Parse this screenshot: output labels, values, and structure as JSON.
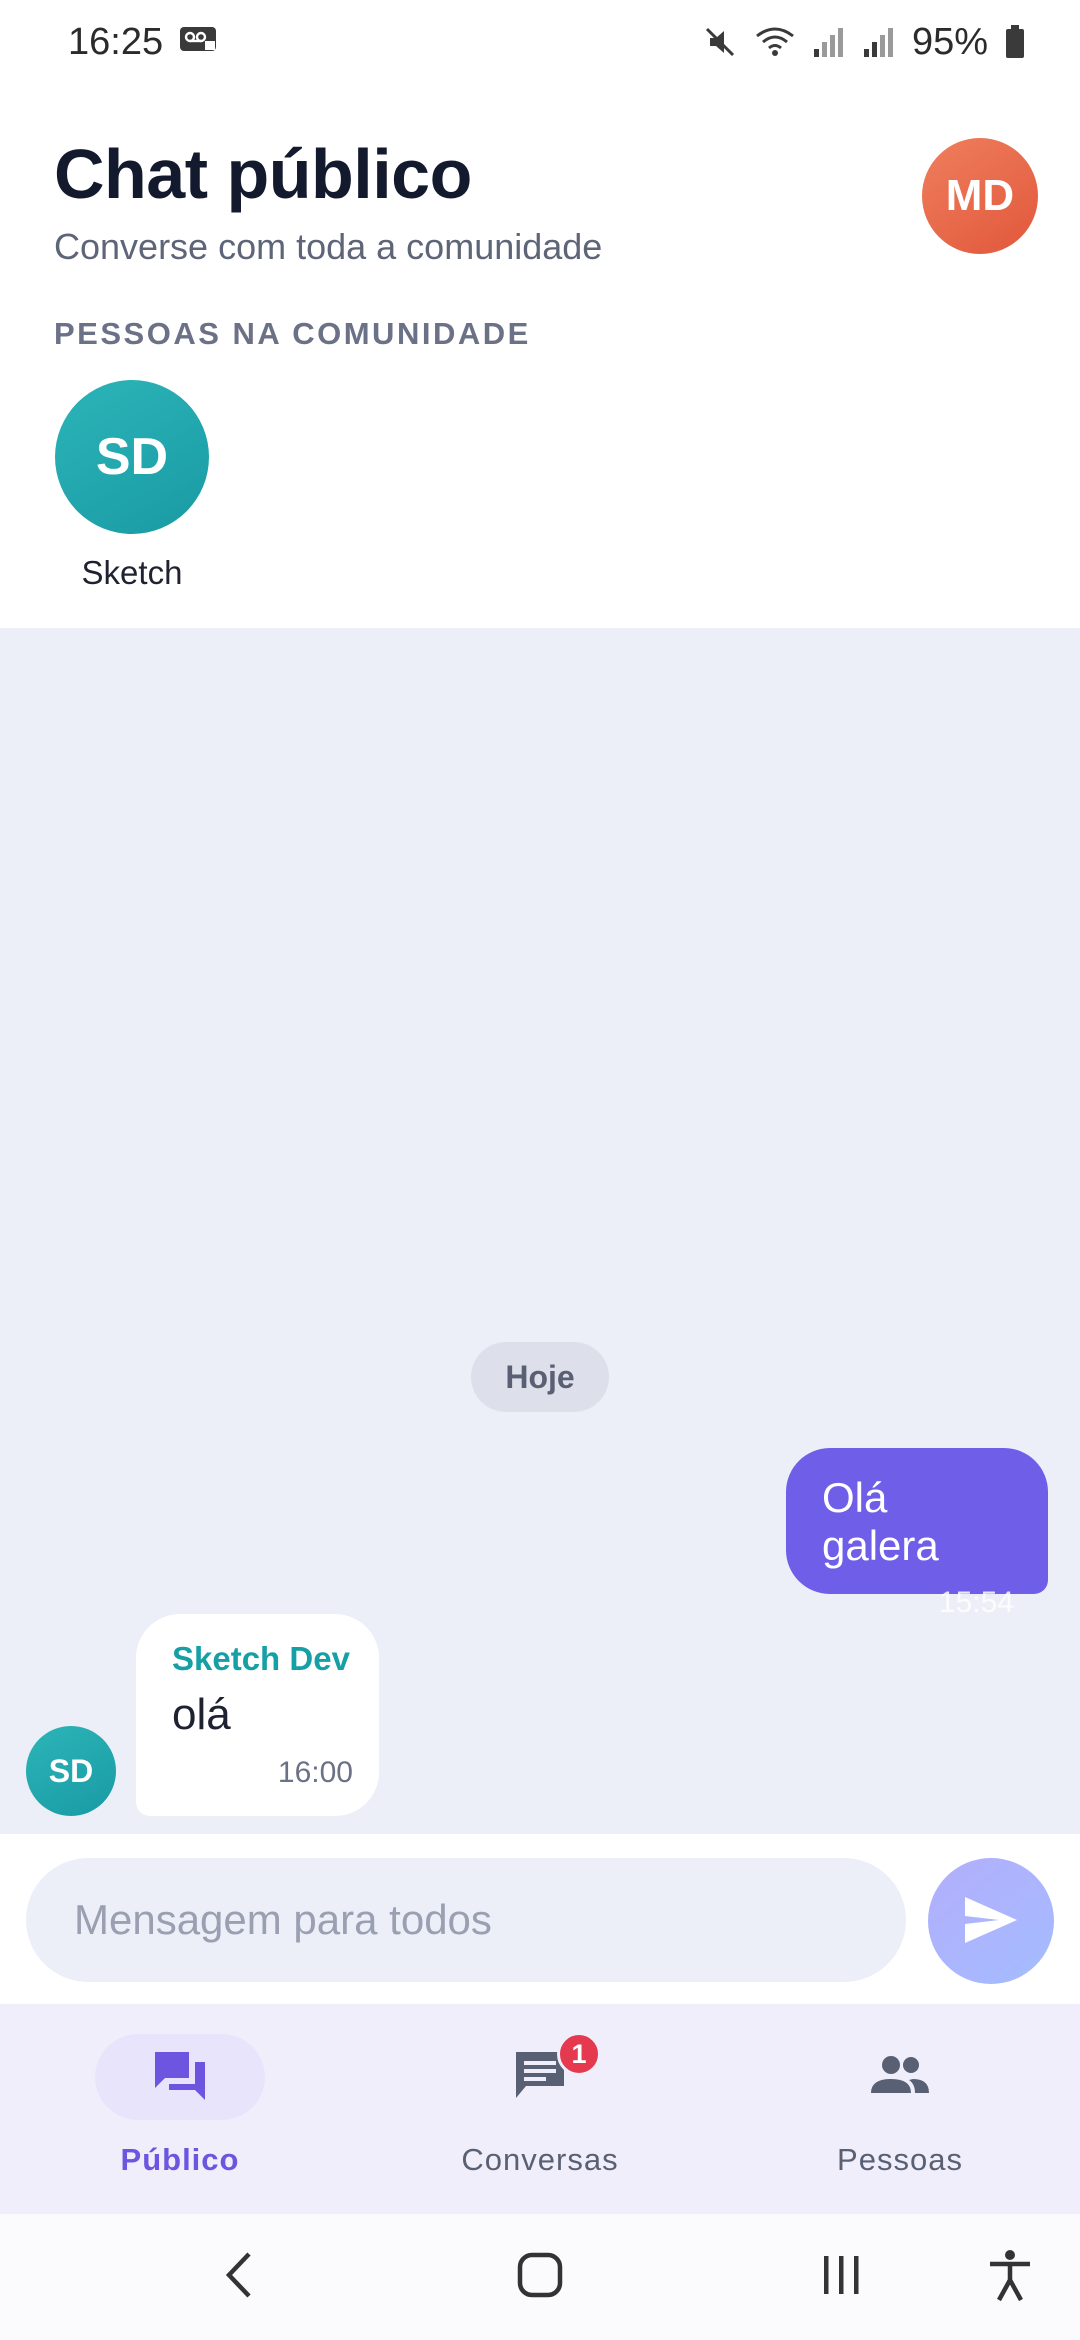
{
  "status_bar": {
    "time": "16:25",
    "battery": "95%"
  },
  "header": {
    "title": "Chat público",
    "subtitle": "Converse com toda a comunidade",
    "profile_initials": "MD",
    "section_label": "PESSOAS NA COMUNIDADE",
    "people": [
      {
        "initials": "SD",
        "name": "Sketch"
      }
    ]
  },
  "chat": {
    "day_label": "Hoje",
    "messages": [
      {
        "direction": "outgoing",
        "text": "Olá galera",
        "time": "15:54"
      },
      {
        "direction": "incoming",
        "sender": "Sketch Dev",
        "initials": "SD",
        "text": "olá",
        "time": "16:00"
      }
    ]
  },
  "composer": {
    "placeholder": "Mensagem para todos",
    "value": ""
  },
  "bottom_nav": {
    "items": [
      {
        "label": "Público",
        "icon": "forum-icon",
        "active": true
      },
      {
        "label": "Conversas",
        "icon": "chat-icon",
        "badge": "1"
      },
      {
        "label": "Pessoas",
        "icon": "people-icon"
      }
    ]
  },
  "colors": {
    "accent": "#6e5ee8",
    "teal": "#16a0a6",
    "profile": "#e8643f",
    "badge": "#e53950",
    "chat_background": "#eceff8"
  }
}
